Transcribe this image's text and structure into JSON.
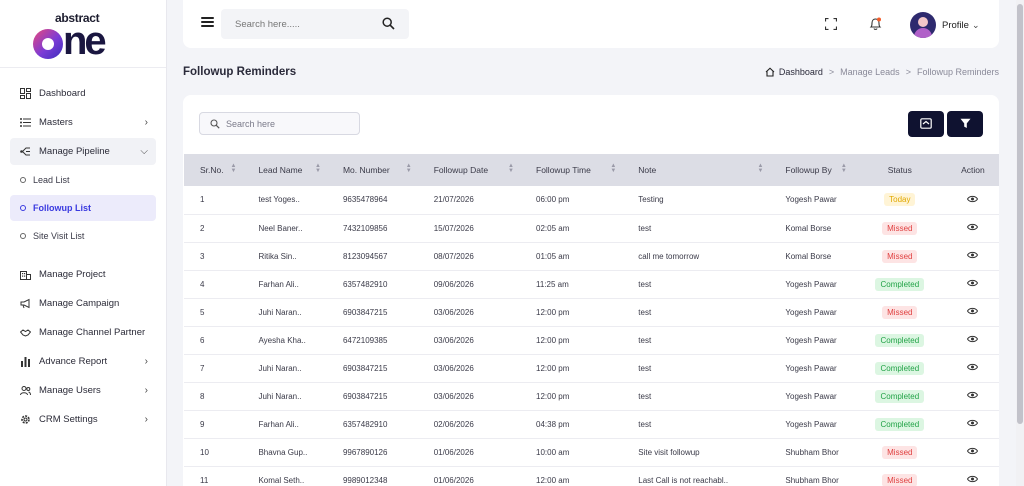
{
  "brand": {
    "small": "abstract",
    "big_rest": "ne"
  },
  "sidebar": {
    "items": [
      {
        "label": "Dashboard",
        "icon": "dashboard-grid-icon"
      },
      {
        "label": "Masters",
        "icon": "list-icon"
      },
      {
        "label": "Manage Pipeline",
        "icon": "pipeline-icon"
      },
      {
        "label": "Manage Project",
        "icon": "building-icon"
      },
      {
        "label": "Manage Campaign",
        "icon": "megaphone-icon"
      },
      {
        "label": "Manage Channel Partner",
        "icon": "handshake-icon"
      },
      {
        "label": "Advance Report",
        "icon": "bar-chart-icon"
      },
      {
        "label": "Manage Users",
        "icon": "users-icon"
      },
      {
        "label": "CRM Settings",
        "icon": "gear-icon"
      }
    ],
    "sub_items": [
      {
        "label": "Lead List"
      },
      {
        "label": "Followup List"
      },
      {
        "label": "Site Visit List"
      }
    ]
  },
  "topbar": {
    "search_placeholder": "Search here.....",
    "profile_label": "Profile"
  },
  "page": {
    "title": "Followup Reminders",
    "breadcrumb": [
      "Dashboard",
      "Manage Leads",
      "Followup Reminders"
    ],
    "breadcrumb_sep": ">"
  },
  "card": {
    "search_placeholder": "Search here"
  },
  "table": {
    "columns": [
      "Sr.No.",
      "Lead Name",
      "Mo. Number",
      "Followup Date",
      "Followup Time",
      "Note",
      "Followup By",
      "Status",
      "Action"
    ],
    "rows": [
      {
        "sr": "1",
        "name": "test Yoges..",
        "mobile": "9635478964",
        "date": "21/07/2026",
        "time": "06:00 pm",
        "note": "Testing",
        "by": "Yogesh Pawar",
        "status": "Today"
      },
      {
        "sr": "2",
        "name": "Neel Baner..",
        "mobile": "7432109856",
        "date": "15/07/2026",
        "time": "02:05 am",
        "note": "test",
        "by": "Komal Borse",
        "status": "Missed"
      },
      {
        "sr": "3",
        "name": "Ritika Sin..",
        "mobile": "8123094567",
        "date": "08/07/2026",
        "time": "01:05 am",
        "note": "call me tomorrow",
        "by": "Komal Borse",
        "status": "Missed"
      },
      {
        "sr": "4",
        "name": "Farhan Ali..",
        "mobile": "6357482910",
        "date": "09/06/2026",
        "time": "11:25 am",
        "note": "test",
        "by": "Yogesh Pawar",
        "status": "Completed"
      },
      {
        "sr": "5",
        "name": "Juhi Naran..",
        "mobile": "6903847215",
        "date": "03/06/2026",
        "time": "12:00 pm",
        "note": "test",
        "by": "Yogesh Pawar",
        "status": "Missed"
      },
      {
        "sr": "6",
        "name": "Ayesha Kha..",
        "mobile": "6472109385",
        "date": "03/06/2026",
        "time": "12:00 pm",
        "note": "test",
        "by": "Yogesh Pawar",
        "status": "Completed"
      },
      {
        "sr": "7",
        "name": "Juhi Naran..",
        "mobile": "6903847215",
        "date": "03/06/2026",
        "time": "12:00 pm",
        "note": "test",
        "by": "Yogesh Pawar",
        "status": "Completed"
      },
      {
        "sr": "8",
        "name": "Juhi Naran..",
        "mobile": "6903847215",
        "date": "03/06/2026",
        "time": "12:00 pm",
        "note": "test",
        "by": "Yogesh Pawar",
        "status": "Completed"
      },
      {
        "sr": "9",
        "name": "Farhan Ali..",
        "mobile": "6357482910",
        "date": "02/06/2026",
        "time": "04:38 pm",
        "note": "test",
        "by": "Yogesh Pawar",
        "status": "Completed"
      },
      {
        "sr": "10",
        "name": "Bhavna Gup..",
        "mobile": "9967890126",
        "date": "01/06/2026",
        "time": "10:00 am",
        "note": "Site visit followup",
        "by": "Shubham Bhor",
        "status": "Missed"
      },
      {
        "sr": "11",
        "name": "Komal Seth..",
        "mobile": "9989012348",
        "date": "01/06/2026",
        "time": "12:00 am",
        "note": "Last Call is not reachabl..",
        "by": "Shubham Bhor",
        "status": "Missed"
      }
    ]
  },
  "colors": {
    "primary_dark": "#0f1230",
    "accent": "#3a3ae0",
    "today": "#e0a800",
    "missed": "#e04141",
    "completed": "#22a347"
  }
}
